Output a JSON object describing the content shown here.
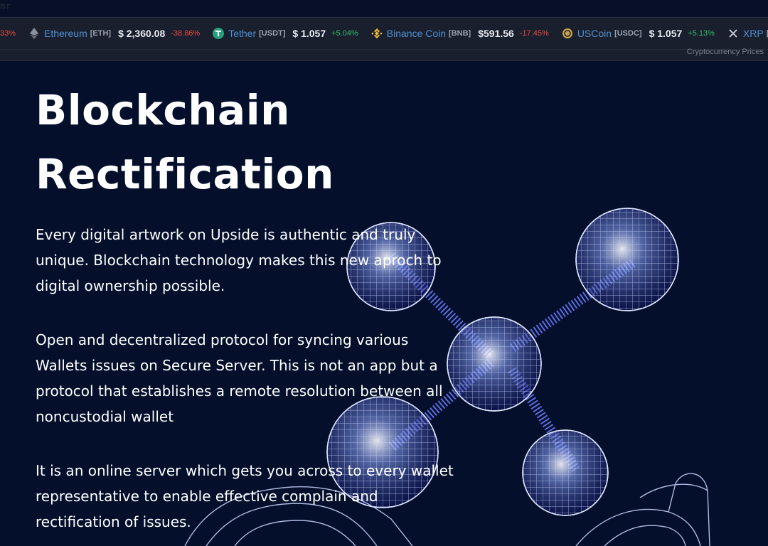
{
  "top_strip": {
    "fragment": "mr"
  },
  "ticker": {
    "items": [
      {
        "icon": "ethereum-icon",
        "name": "",
        "symbol": "",
        "price": "",
        "change": "33%",
        "direction": "neg"
      },
      {
        "icon": "ethereum-icon",
        "name": "Ethereum",
        "symbol": "[ETH]",
        "price": "$ 2,360.08",
        "change": "-38.86%",
        "direction": "neg"
      },
      {
        "icon": "tether-icon",
        "name": "Tether",
        "symbol": "[USDT]",
        "price": "$ 1.057",
        "change": "+5.04%",
        "direction": "pos"
      },
      {
        "icon": "binance-coin-icon",
        "name": "Binance Coin",
        "symbol": "[BNB]",
        "price": "$591.56",
        "change": "-17.45%",
        "direction": "neg"
      },
      {
        "icon": "usdc-icon",
        "name": "USCoin",
        "symbol": "[USDC]",
        "price": "$ 1.057",
        "change": "+5.13%",
        "direction": "pos"
      },
      {
        "icon": "xrp-icon",
        "name": "XRP",
        "symbol": "[XRP",
        "price": "",
        "change": "",
        "direction": ""
      }
    ],
    "footer_label": "Cryptocurrency Prices",
    "colors": {
      "negative": "#e84b3c",
      "positive": "#2fbf6a",
      "name": "#4f8fd0"
    }
  },
  "hero": {
    "title_line1": "Blockchain",
    "title_line2": "Rectification",
    "paragraphs": [
      "Every digital artwork on Upside is authentic and truly unique. Blockchain technology makes this new aproch to digital ownership possible.",
      "Open and decentralized protocol for syncing various Wallets issues on Secure Server. This is not an app but a protocol that establishes a remote resolution between all noncustodial wallet",
      "It is an online server which gets you across to every wallet representative to enable effective complain and rectification of issues."
    ],
    "art": "blockchain-molecule-hand-illustration"
  }
}
